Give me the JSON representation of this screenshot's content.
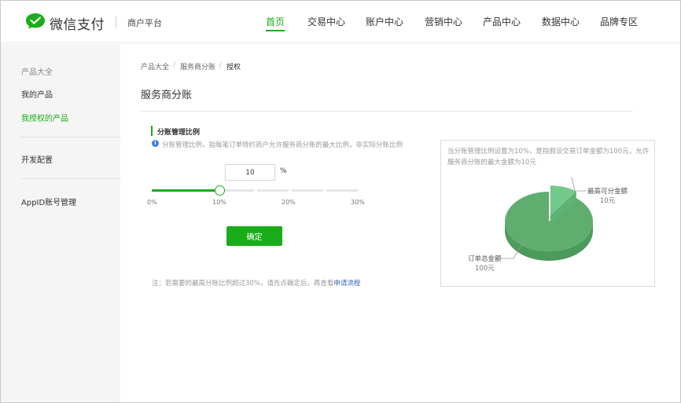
{
  "header": {
    "brand": "微信支付",
    "sub_brand": "商户平台",
    "nav": [
      {
        "label": "首页",
        "active": true
      },
      {
        "label": "交易中心"
      },
      {
        "label": "账户中心"
      },
      {
        "label": "营销中心"
      },
      {
        "label": "产品中心"
      },
      {
        "label": "数据中心"
      },
      {
        "label": "品牌专区"
      }
    ]
  },
  "sidebar": {
    "group_label": "产品大全",
    "items": [
      {
        "label": "我的产品"
      },
      {
        "label": "我授权的产品",
        "active": true
      },
      {
        "label": "开发配置"
      },
      {
        "label": "AppID账号管理"
      }
    ]
  },
  "breadcrumb": [
    "产品大全",
    "服务商分账",
    "授权"
  ],
  "breadcrumb_sep": "/",
  "page_title": "服务商分账",
  "section": {
    "title": "分账管理比例",
    "info_icon": "info-icon",
    "description": "分账管理比例，指每笔订单特约商户允许服务商分账的最大比例，非实际分账比例"
  },
  "ratio": {
    "value": "10",
    "unit": "%",
    "slider_percent": 10,
    "ticks": [
      "0%",
      "10%",
      "20%",
      "30%"
    ]
  },
  "confirm_label": "确定",
  "note": {
    "text": "注：若需要的最高分账比例超过30%，请先点确定后，再查看",
    "link": "申请流程"
  },
  "panel": {
    "text": "当分账管理比例设置为10%，是指假设交易订单金额为100元，允许服务商分账的最大金额为10元",
    "pie": {
      "slices": [
        {
          "name": "最高可分金额",
          "value": "10元",
          "amount": 10
        },
        {
          "name": "订单总金额",
          "value": "100元",
          "amount": 90
        }
      ],
      "colors": {
        "main": "#5fae6f",
        "main_side": "#4c9a5c",
        "slice": "#73c98a",
        "slice_side": "#5db274",
        "leader": "#9a9a9a"
      }
    }
  },
  "colors": {
    "accent": "#1aad19",
    "link": "#3e64b8"
  }
}
